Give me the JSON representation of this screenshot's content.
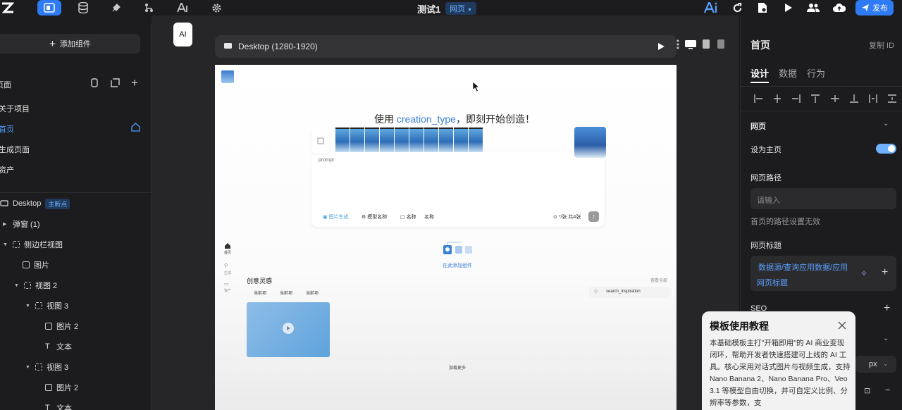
{
  "topbar": {
    "title": "测试1",
    "page_badge": "网页",
    "publish_label": "发布",
    "ai_tooltip": "AI"
  },
  "left_panel": {
    "add_component_label": "添加组件",
    "pages_header": "页面",
    "pages": [
      {
        "label": "关于项目"
      },
      {
        "label": "首页"
      },
      {
        "label": "生成页面"
      },
      {
        "label": "资产"
      }
    ],
    "tree": {
      "root_label": "Desktop",
      "root_badge": "主断点",
      "items": [
        {
          "label": "弹窗 (1)"
        },
        {
          "label": "侧边栏视图"
        },
        {
          "label": "图片"
        },
        {
          "label": "视图 2"
        },
        {
          "label": "视图 3"
        },
        {
          "label": "图片 2"
        },
        {
          "label": "文本"
        },
        {
          "label": "视图 3"
        },
        {
          "label": "图片 2"
        },
        {
          "label": "文本"
        }
      ]
    }
  },
  "canvas": {
    "device_label": "Desktop (1280-1920)",
    "page": {
      "headline_pre": "使用 ",
      "headline_highlight": "creation_type",
      "headline_post": "，即刻开始创造！",
      "prompt_placeholder": "prompt",
      "tool_image": "图片生成",
      "tool_model": "模型名称",
      "tool_name": "名称",
      "tool_name2": "名称",
      "cost_label": "*/张 共4张",
      "nav_home": "首页",
      "nav_generate": "生成",
      "nav_assets": "资产",
      "add_here": "在此添加组件",
      "inspiration_title": "创意灵感",
      "view_all": "查看全部",
      "filters": [
        "当前项",
        "当前项",
        "当前项"
      ],
      "search_placeholder": "search_inspiration",
      "load_more": "加载更多"
    }
  },
  "right_panel": {
    "page_title": "首页",
    "copy_id": "复制 ID",
    "tabs": [
      "设计",
      "数据",
      "行为"
    ],
    "section_webpage": "网页",
    "set_home_label": "设为主页",
    "set_home_on": true,
    "path_label": "网页路径",
    "path_placeholder": "请输入",
    "path_hint": "首页的路径设置无效",
    "title_label": "网页标题",
    "title_value_1": "数据源/查询应用数据/应用",
    "title_value_2": "网页标题",
    "seo_label": "SEO",
    "unit": "px"
  },
  "tutorial": {
    "title": "模板使用教程",
    "body": "本基础模板主打\"开箱即用\"的 AI 商业变现闭环，帮助开发者快速搭建可上线的 AI 工具。核心采用对话式图片与视频生成，支持 Nano Banana 2、Nano Banana Pro、Veo 3.1 等模型自由切换，并可自定义比例、分辨率等参数，支"
  },
  "colors": {
    "accent": "#2f7bf5",
    "highlight": "#3b7fd8",
    "panel": "#1c1c1e"
  }
}
